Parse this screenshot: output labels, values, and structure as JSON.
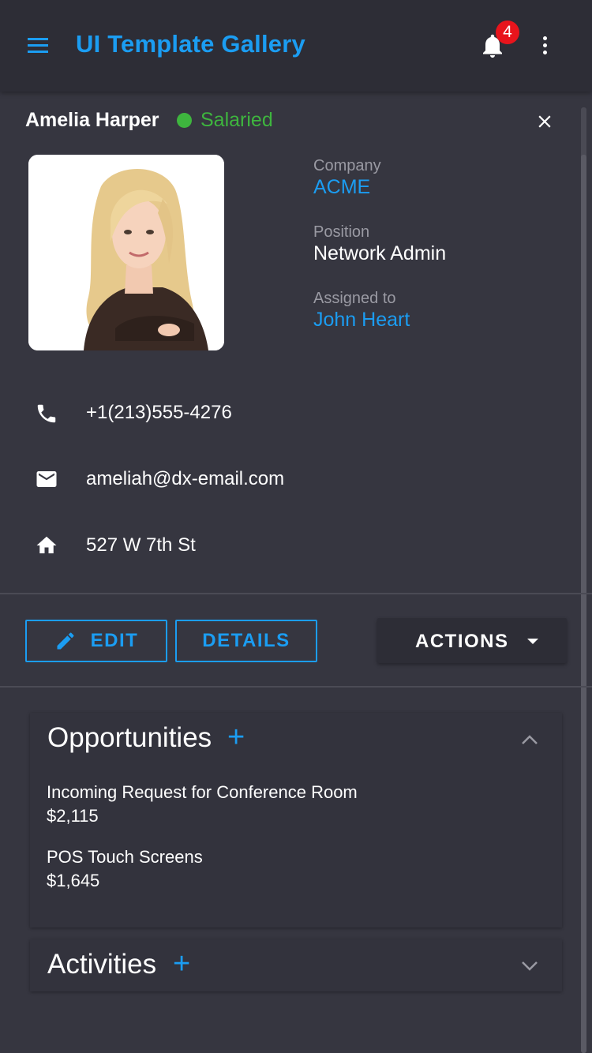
{
  "app": {
    "title": "UI Template Gallery",
    "notification_count": "4",
    "accent_color": "#1b9df2"
  },
  "profile": {
    "name": "Amelia Harper",
    "status": "Salaried",
    "status_color": "#3eb53e",
    "company_label": "Company",
    "company": "ACME",
    "position_label": "Position",
    "position": "Network Admin",
    "assigned_label": "Assigned to",
    "assigned_to": "John Heart"
  },
  "contacts": [
    {
      "icon": "phone-icon",
      "text": "+1(213)555-4276"
    },
    {
      "icon": "email-icon",
      "text": "ameliah@dx-email.com"
    },
    {
      "icon": "home-icon",
      "text": "527 W 7th St"
    }
  ],
  "actions": {
    "edit": "EDIT",
    "details": "DETAILS",
    "actions": "ACTIONS"
  },
  "opportunities": {
    "title": "Opportunities",
    "plus": "+",
    "items": [
      {
        "title": "Incoming Request for Conference Room",
        "amount": "$2,115"
      },
      {
        "title": "POS Touch Screens",
        "amount": "$1,645"
      }
    ]
  },
  "activities": {
    "title": "Activities",
    "plus": "+"
  }
}
